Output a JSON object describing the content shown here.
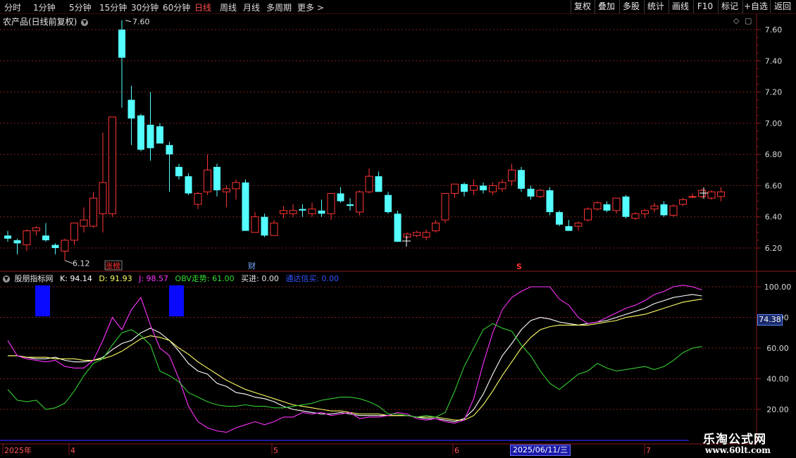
{
  "toolbar": {
    "periods": [
      "分时",
      "1分钟",
      "5分钟",
      "15分钟",
      "30分钟",
      "60分钟",
      "日线",
      "周线",
      "月线",
      "多周期",
      "更多 >"
    ],
    "active_period": "日线",
    "right_buttons": [
      "复权",
      "叠加",
      "多股",
      "统计",
      "画线",
      "F10",
      "标记",
      "+自选",
      "返回"
    ]
  },
  "stock_title": "农产品(日线前复权)",
  "indicator": {
    "name": "股朋指标网",
    "K": "K: 94.14",
    "D": "D: 91.93",
    "J": "J: 98.57",
    "OBV": "OBV走势: 61.00",
    "buy": "买进: 0.00",
    "signal": "通达信买: 0.00"
  },
  "annotations": {
    "high_label": "7.60",
    "low_label": "6.12",
    "zhangbang": "涨榜",
    "cai": "财",
    "s_mark": "S"
  },
  "crosshair_value": "74.38",
  "date_highlight": "2025/06/11/三",
  "x_axis_labels": [
    "2025年",
    "4",
    "5",
    "6",
    "7"
  ],
  "watermark": {
    "line1": "乐淘公式网",
    "line2": "www.60lt.com"
  },
  "colors": {
    "up": "#ff3333",
    "down": "#54ffff",
    "k": "#ffffff",
    "d": "#ffff66",
    "j": "#ff33ff",
    "obv": "#33cc33",
    "grid": "#7a1f1f"
  },
  "chart_data": [
    {
      "type": "candlestick",
      "title": "农产品(日线前复权)",
      "ylim": [
        6.12,
        7.66
      ],
      "y_ticks": [
        6.2,
        6.4,
        6.6,
        6.8,
        7.0,
        7.2,
        7.4,
        7.6
      ],
      "ohlc": [
        [
          6.28,
          6.31,
          6.24,
          6.26
        ],
        [
          6.25,
          6.26,
          6.16,
          6.23
        ],
        [
          6.22,
          6.32,
          6.18,
          6.31
        ],
        [
          6.31,
          6.34,
          6.28,
          6.33
        ],
        [
          6.28,
          6.36,
          6.24,
          6.25
        ],
        [
          6.22,
          6.23,
          6.16,
          6.2
        ],
        [
          6.18,
          6.26,
          6.12,
          6.25
        ],
        [
          6.25,
          6.36,
          6.22,
          6.36
        ],
        [
          6.34,
          6.46,
          6.3,
          6.38
        ],
        [
          6.34,
          6.56,
          6.33,
          6.52
        ],
        [
          6.42,
          6.94,
          6.3,
          6.62
        ],
        [
          6.42,
          7.04,
          6.4,
          7.04
        ],
        [
          7.6,
          7.66,
          7.1,
          7.42
        ],
        [
          7.15,
          7.24,
          6.86,
          7.03
        ],
        [
          7.05,
          7.06,
          6.82,
          6.83
        ],
        [
          6.99,
          7.2,
          6.76,
          6.84
        ],
        [
          6.98,
          7.0,
          6.88,
          6.87
        ],
        [
          6.86,
          6.88,
          6.56,
          6.8
        ],
        [
          6.72,
          6.74,
          6.64,
          6.66
        ],
        [
          6.66,
          6.68,
          6.54,
          6.55
        ],
        [
          6.48,
          6.56,
          6.45,
          6.55
        ],
        [
          6.56,
          6.8,
          6.54,
          6.7
        ],
        [
          6.72,
          6.74,
          6.53,
          6.57
        ],
        [
          6.56,
          6.6,
          6.46,
          6.58
        ],
        [
          6.58,
          6.64,
          6.51,
          6.62
        ],
        [
          6.62,
          6.64,
          6.32,
          6.31
        ],
        [
          6.3,
          6.43,
          6.3,
          6.4
        ],
        [
          6.4,
          6.42,
          6.27,
          6.28
        ],
        [
          6.28,
          6.38,
          6.28,
          6.36
        ],
        [
          6.42,
          6.47,
          6.39,
          6.44
        ],
        [
          6.42,
          6.48,
          6.4,
          6.44
        ],
        [
          6.45,
          6.48,
          6.4,
          6.44
        ],
        [
          6.42,
          6.49,
          6.4,
          6.45
        ],
        [
          6.44,
          6.51,
          6.4,
          6.42
        ],
        [
          6.42,
          6.55,
          6.38,
          6.55
        ],
        [
          6.55,
          6.59,
          6.49,
          6.5
        ],
        [
          6.48,
          6.52,
          6.44,
          6.47
        ],
        [
          6.43,
          6.57,
          6.41,
          6.56
        ],
        [
          6.56,
          6.71,
          6.55,
          6.66
        ],
        [
          6.66,
          6.69,
          6.56,
          6.56
        ],
        [
          6.54,
          6.56,
          6.42,
          6.43
        ],
        [
          6.42,
          6.44,
          6.24,
          6.24
        ],
        [
          6.27,
          6.3,
          6.26,
          6.29
        ],
        [
          6.28,
          6.31,
          6.27,
          6.3
        ],
        [
          6.27,
          6.32,
          6.25,
          6.3
        ],
        [
          6.31,
          6.38,
          6.3,
          6.36
        ],
        [
          6.38,
          6.55,
          6.36,
          6.55
        ],
        [
          6.55,
          6.61,
          6.52,
          6.61
        ],
        [
          6.61,
          6.62,
          6.53,
          6.56
        ],
        [
          6.57,
          6.64,
          6.54,
          6.6
        ],
        [
          6.6,
          6.62,
          6.55,
          6.57
        ],
        [
          6.56,
          6.62,
          6.54,
          6.6
        ],
        [
          6.58,
          6.64,
          6.56,
          6.62
        ],
        [
          6.63,
          6.74,
          6.6,
          6.7
        ],
        [
          6.7,
          6.72,
          6.56,
          6.58
        ],
        [
          6.58,
          6.6,
          6.51,
          6.53
        ],
        [
          6.53,
          6.58,
          6.52,
          6.57
        ],
        [
          6.57,
          6.59,
          6.41,
          6.43
        ],
        [
          6.43,
          6.44,
          6.34,
          6.35
        ],
        [
          6.34,
          6.38,
          6.31,
          6.31
        ],
        [
          6.34,
          6.37,
          6.31,
          6.36
        ],
        [
          6.38,
          6.46,
          6.37,
          6.45
        ],
        [
          6.45,
          6.5,
          6.44,
          6.49
        ],
        [
          6.48,
          6.5,
          6.43,
          6.44
        ],
        [
          6.44,
          6.52,
          6.42,
          6.52
        ],
        [
          6.53,
          6.54,
          6.39,
          6.4
        ],
        [
          6.39,
          6.43,
          6.38,
          6.42
        ],
        [
          6.42,
          6.45,
          6.39,
          6.44
        ],
        [
          6.45,
          6.49,
          6.43,
          6.47
        ],
        [
          6.48,
          6.5,
          6.4,
          6.41
        ],
        [
          6.41,
          6.48,
          6.4,
          6.47
        ],
        [
          6.48,
          6.52,
          6.47,
          6.51
        ],
        [
          6.53,
          6.55,
          6.52,
          6.53
        ],
        [
          6.53,
          6.58,
          6.52,
          6.57
        ],
        [
          6.52,
          6.57,
          6.51,
          6.56
        ],
        [
          6.53,
          6.59,
          6.5,
          6.56
        ]
      ]
    },
    {
      "type": "line",
      "title": "股朋指标网",
      "ylim": [
        0,
        105
      ],
      "y_ticks": [
        20,
        40,
        60,
        80,
        100
      ],
      "series": [
        {
          "name": "K",
          "values": [
            55,
            55,
            54,
            53,
            53,
            54,
            52,
            51,
            51,
            52,
            54,
            59,
            63,
            65,
            70,
            73,
            70,
            65,
            58,
            50,
            45,
            43,
            37,
            35,
            31,
            30,
            28,
            27,
            25,
            22,
            20,
            19,
            18,
            17,
            17,
            18,
            17,
            16,
            16,
            16,
            16,
            16,
            16,
            15,
            14,
            14,
            13,
            12,
            14,
            20,
            30,
            43,
            55,
            63,
            72,
            78,
            80,
            79,
            77,
            76,
            75,
            76,
            77,
            78,
            80,
            82,
            84,
            86,
            89,
            91,
            93,
            94,
            95,
            94
          ]
        },
        {
          "name": "D",
          "values": [
            55,
            55,
            54,
            54,
            54,
            53,
            53,
            53,
            52,
            52,
            53,
            55,
            58,
            62,
            66,
            68,
            67,
            65,
            60,
            56,
            51,
            47,
            43,
            39,
            36,
            33,
            31,
            29,
            27,
            25,
            23,
            22,
            21,
            20,
            19,
            19,
            18,
            17,
            17,
            17,
            16,
            16,
            16,
            15,
            15,
            15,
            14,
            13,
            13,
            16,
            23,
            32,
            42,
            51,
            60,
            67,
            72,
            74,
            75,
            75,
            75,
            75,
            76,
            77,
            78,
            80,
            81,
            82,
            84,
            86,
            88,
            90,
            91,
            92
          ]
        },
        {
          "name": "J",
          "values": [
            65,
            55,
            53,
            52,
            51,
            52,
            48,
            47,
            47,
            52,
            65,
            80,
            72,
            85,
            93,
            75,
            60,
            55,
            40,
            22,
            12,
            8,
            6,
            5,
            8,
            10,
            12,
            10,
            12,
            15,
            15,
            18,
            17,
            18,
            16,
            17,
            18,
            14,
            15,
            15,
            16,
            18,
            17,
            14,
            13,
            14,
            12,
            11,
            13,
            27,
            50,
            70,
            85,
            93,
            97,
            100,
            100,
            100,
            92,
            88,
            80,
            76,
            77,
            80,
            83,
            86,
            88,
            91,
            95,
            97,
            100,
            101,
            100,
            98
          ]
        },
        {
          "name": "OBV走势",
          "values": [
            33,
            26,
            25,
            26,
            20,
            21,
            24,
            32,
            42,
            50,
            53,
            62,
            70,
            72,
            68,
            62,
            45,
            42,
            38,
            31,
            28,
            25,
            23,
            22,
            22,
            23,
            22,
            22,
            21,
            21,
            22,
            23,
            24,
            26,
            27,
            28,
            28,
            27,
            25,
            22,
            17,
            17,
            16,
            15,
            16,
            15,
            18,
            32,
            48,
            60,
            72,
            76,
            73,
            71,
            62,
            55,
            45,
            37,
            33,
            38,
            43,
            45,
            50,
            47,
            45,
            46,
            47,
            48,
            46,
            48,
            52,
            57,
            60,
            61
          ]
        }
      ]
    }
  ]
}
